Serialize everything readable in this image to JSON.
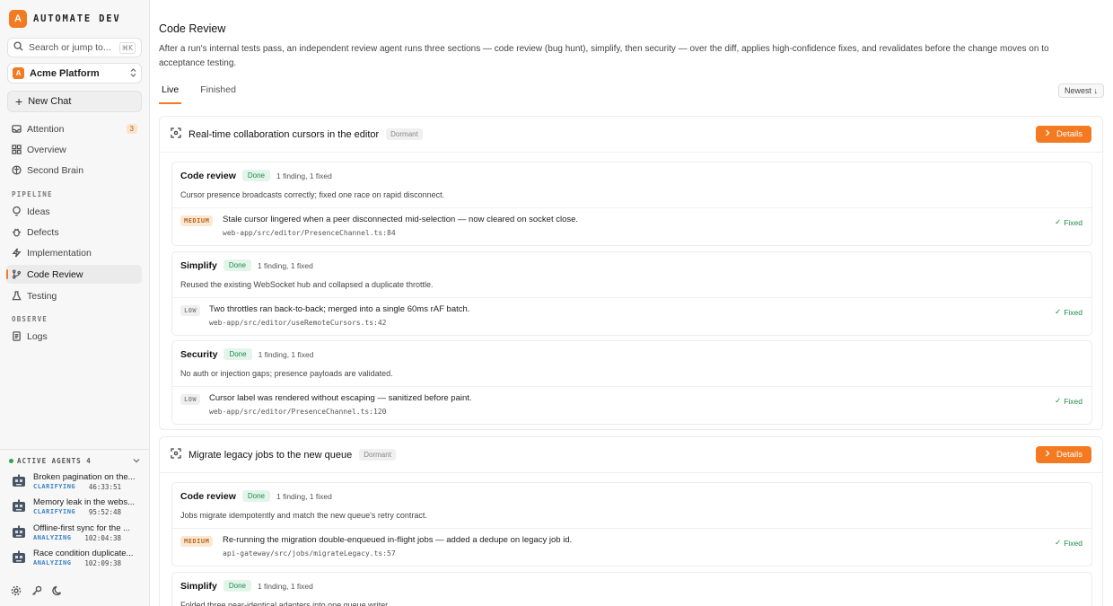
{
  "brand": {
    "logo_letter": "A",
    "name": "AUTOMATE DEV"
  },
  "search": {
    "placeholder": "Search or jump to...",
    "shortcut": "⌘K"
  },
  "workspace": {
    "logo_letter": "A",
    "name": "Acme Platform"
  },
  "new_chat": {
    "label": "New Chat"
  },
  "nav_top": [
    {
      "label": "Attention",
      "count": "3",
      "icon": "inbox-icon"
    },
    {
      "label": "Overview",
      "icon": "grid-icon"
    },
    {
      "label": "Second Brain",
      "icon": "brain-icon"
    }
  ],
  "sections": {
    "pipeline": "PIPELINE",
    "observe": "OBSERVE"
  },
  "nav_pipeline": [
    {
      "label": "Ideas",
      "icon": "lightbulb-icon"
    },
    {
      "label": "Defects",
      "icon": "bug-icon"
    },
    {
      "label": "Implementation",
      "icon": "bolt-icon"
    },
    {
      "label": "Code Review",
      "icon": "branch-icon",
      "active": true
    },
    {
      "label": "Testing",
      "icon": "flask-icon"
    }
  ],
  "nav_observe": [
    {
      "label": "Logs",
      "icon": "logs-icon"
    }
  ],
  "agents": {
    "title": "ACTIVE AGENTS",
    "count": "4",
    "items": [
      {
        "title": "Broken pagination on the...",
        "status": "CLARIFYING",
        "time": "46:33:51"
      },
      {
        "title": "Memory leak in the webs...",
        "status": "CLARIFYING",
        "time": "95:52:48"
      },
      {
        "title": "Offline-first sync for the ...",
        "status": "ANALYZING",
        "time": "102:04:38"
      },
      {
        "title": "Race condition duplicate...",
        "status": "ANALYZING",
        "time": "102:09:38"
      }
    ]
  },
  "main": {
    "title": "Code Review",
    "description": "After a run's internal tests pass, an independent review agent runs three sections — code review (bug hunt), simplify, then security — over the diff, applies high-confidence fixes, and revalidates before the change moves on to acceptance testing.",
    "tabs": [
      "Live",
      "Finished"
    ],
    "sort": "Newest ↓"
  },
  "cards": [
    {
      "title": "Real-time collaboration cursors in the editor",
      "state": "Dormant",
      "details_label": "Details",
      "sections": [
        {
          "name": "Code review",
          "status": "Done",
          "count": "1 finding, 1 fixed",
          "summary": "Cursor presence broadcasts correctly; fixed one race on rapid disconnect.",
          "finding": {
            "severity": "MEDIUM",
            "text": "Stale cursor lingered when a peer disconnected mid-selection — now cleared on socket close.",
            "path": "web-app/src/editor/PresenceChannel.ts:84",
            "result": "Fixed"
          }
        },
        {
          "name": "Simplify",
          "status": "Done",
          "count": "1 finding, 1 fixed",
          "summary": "Reused the existing WebSocket hub and collapsed a duplicate throttle.",
          "finding": {
            "severity": "LOW",
            "text": "Two throttles ran back-to-back; merged into a single 60ms rAF batch.",
            "path": "web-app/src/editor/useRemoteCursors.ts:42",
            "result": "Fixed"
          }
        },
        {
          "name": "Security",
          "status": "Done",
          "count": "1 finding, 1 fixed",
          "summary": "No auth or injection gaps; presence payloads are validated.",
          "finding": {
            "severity": "LOW",
            "text": "Cursor label was rendered without escaping — sanitized before paint.",
            "path": "web-app/src/editor/PresenceChannel.ts:120",
            "result": "Fixed"
          }
        }
      ]
    },
    {
      "title": "Migrate legacy jobs to the new queue",
      "state": "Dormant",
      "details_label": "Details",
      "sections": [
        {
          "name": "Code review",
          "status": "Done",
          "count": "1 finding, 1 fixed",
          "summary": "Jobs migrate idempotently and match the new queue's retry contract.",
          "finding": {
            "severity": "MEDIUM",
            "text": "Re-running the migration double-enqueued in-flight jobs — added a dedupe on legacy job id.",
            "path": "api-gateway/src/jobs/migrateLegacy.ts:57",
            "result": "Fixed"
          }
        },
        {
          "name": "Simplify",
          "status": "Done",
          "count": "1 finding, 1 fixed",
          "summary": "Folded three near-identical adapters into one queue writer."
        }
      ]
    }
  ]
}
